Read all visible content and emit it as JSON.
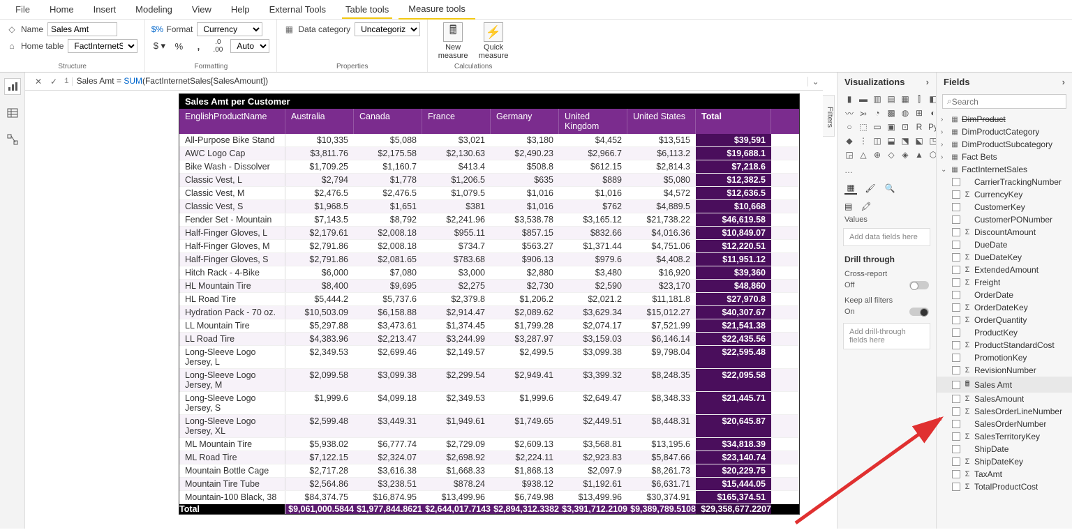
{
  "ribbon": {
    "tabs": [
      "File",
      "Home",
      "Insert",
      "Modeling",
      "View",
      "Help",
      "External Tools",
      "Table tools",
      "Measure tools"
    ],
    "active_tab": "Measure tools",
    "highlight_tab": "Table tools",
    "structure": {
      "name_label": "Name",
      "name_value": "Sales Amt",
      "home_table_label": "Home table",
      "home_table_value": "FactInternetSales",
      "group_label": "Structure"
    },
    "formatting": {
      "format_label": "Format",
      "format_value": "Currency",
      "decimals_value": "Auto",
      "group_label": "Formatting"
    },
    "properties": {
      "data_category_label": "Data category",
      "data_category_value": "Uncategorized",
      "group_label": "Properties"
    },
    "calculations": {
      "new_measure": "New measure",
      "quick_measure": "Quick measure",
      "group_label": "Calculations"
    }
  },
  "formula_bar": {
    "line": "1",
    "prefix": "Sales Amt = ",
    "func": "SUM",
    "args": "(FactInternetSales[SalesAmount])"
  },
  "filters_label": "Filters",
  "matrix": {
    "title": "Sales Amt per Customer",
    "row_header": "EnglishProductName",
    "col_headers": [
      "Australia",
      "Canada",
      "France",
      "Germany",
      "United Kingdom",
      "United States",
      "Total"
    ],
    "rows": [
      {
        "name": "All-Purpose Bike Stand",
        "v": [
          "$10,335",
          "$5,088",
          "$3,021",
          "$3,180",
          "$4,452",
          "$13,515",
          "$39,591"
        ]
      },
      {
        "name": "AWC Logo Cap",
        "v": [
          "$3,811.76",
          "$2,175.58",
          "$2,130.63",
          "$2,490.23",
          "$2,966.7",
          "$6,113.2",
          "$19,688.1"
        ]
      },
      {
        "name": "Bike Wash - Dissolver",
        "v": [
          "$1,709.25",
          "$1,160.7",
          "$413.4",
          "$508.8",
          "$612.15",
          "$2,814.3",
          "$7,218.6"
        ]
      },
      {
        "name": "Classic Vest, L",
        "v": [
          "$2,794",
          "$1,778",
          "$1,206.5",
          "$635",
          "$889",
          "$5,080",
          "$12,382.5"
        ]
      },
      {
        "name": "Classic Vest, M",
        "v": [
          "$2,476.5",
          "$2,476.5",
          "$1,079.5",
          "$1,016",
          "$1,016",
          "$4,572",
          "$12,636.5"
        ]
      },
      {
        "name": "Classic Vest, S",
        "v": [
          "$1,968.5",
          "$1,651",
          "$381",
          "$1,016",
          "$762",
          "$4,889.5",
          "$10,668"
        ]
      },
      {
        "name": "Fender Set - Mountain",
        "v": [
          "$7,143.5",
          "$8,792",
          "$2,241.96",
          "$3,538.78",
          "$3,165.12",
          "$21,738.22",
          "$46,619.58"
        ]
      },
      {
        "name": "Half-Finger Gloves, L",
        "v": [
          "$2,179.61",
          "$2,008.18",
          "$955.11",
          "$857.15",
          "$832.66",
          "$4,016.36",
          "$10,849.07"
        ]
      },
      {
        "name": "Half-Finger Gloves, M",
        "v": [
          "$2,791.86",
          "$2,008.18",
          "$734.7",
          "$563.27",
          "$1,371.44",
          "$4,751.06",
          "$12,220.51"
        ]
      },
      {
        "name": "Half-Finger Gloves, S",
        "v": [
          "$2,791.86",
          "$2,081.65",
          "$783.68",
          "$906.13",
          "$979.6",
          "$4,408.2",
          "$11,951.12"
        ]
      },
      {
        "name": "Hitch Rack - 4-Bike",
        "v": [
          "$6,000",
          "$7,080",
          "$3,000",
          "$2,880",
          "$3,480",
          "$16,920",
          "$39,360"
        ]
      },
      {
        "name": "HL Mountain Tire",
        "v": [
          "$8,400",
          "$9,695",
          "$2,275",
          "$2,730",
          "$2,590",
          "$23,170",
          "$48,860"
        ]
      },
      {
        "name": "HL Road Tire",
        "v": [
          "$5,444.2",
          "$5,737.6",
          "$2,379.8",
          "$1,206.2",
          "$2,021.2",
          "$11,181.8",
          "$27,970.8"
        ]
      },
      {
        "name": "Hydration Pack - 70 oz.",
        "v": [
          "$10,503.09",
          "$6,158.88",
          "$2,914.47",
          "$2,089.62",
          "$3,629.34",
          "$15,012.27",
          "$40,307.67"
        ]
      },
      {
        "name": "LL Mountain Tire",
        "v": [
          "$5,297.88",
          "$3,473.61",
          "$1,374.45",
          "$1,799.28",
          "$2,074.17",
          "$7,521.99",
          "$21,541.38"
        ]
      },
      {
        "name": "LL Road Tire",
        "v": [
          "$4,383.96",
          "$2,213.47",
          "$3,244.99",
          "$3,287.97",
          "$3,159.03",
          "$6,146.14",
          "$22,435.56"
        ]
      },
      {
        "name": "Long-Sleeve Logo Jersey, L",
        "v": [
          "$2,349.53",
          "$2,699.46",
          "$2,149.57",
          "$2,499.5",
          "$3,099.38",
          "$9,798.04",
          "$22,595.48"
        ]
      },
      {
        "name": "Long-Sleeve Logo Jersey, M",
        "v": [
          "$2,099.58",
          "$3,099.38",
          "$2,299.54",
          "$2,949.41",
          "$3,399.32",
          "$8,248.35",
          "$22,095.58"
        ]
      },
      {
        "name": "Long-Sleeve Logo Jersey, S",
        "v": [
          "$1,999.6",
          "$4,099.18",
          "$2,349.53",
          "$1,999.6",
          "$2,649.47",
          "$8,348.33",
          "$21,445.71"
        ]
      },
      {
        "name": "Long-Sleeve Logo Jersey, XL",
        "v": [
          "$2,599.48",
          "$3,449.31",
          "$1,949.61",
          "$1,749.65",
          "$2,449.51",
          "$8,448.31",
          "$20,645.87"
        ]
      },
      {
        "name": "ML Mountain Tire",
        "v": [
          "$5,938.02",
          "$6,777.74",
          "$2,729.09",
          "$2,609.13",
          "$3,568.81",
          "$13,195.6",
          "$34,818.39"
        ]
      },
      {
        "name": "ML Road Tire",
        "v": [
          "$7,122.15",
          "$2,324.07",
          "$2,698.92",
          "$2,224.11",
          "$2,923.83",
          "$5,847.66",
          "$23,140.74"
        ]
      },
      {
        "name": "Mountain Bottle Cage",
        "v": [
          "$2,717.28",
          "$3,616.38",
          "$1,668.33",
          "$1,868.13",
          "$2,097.9",
          "$8,261.73",
          "$20,229.75"
        ]
      },
      {
        "name": "Mountain Tire Tube",
        "v": [
          "$2,564.86",
          "$3,238.51",
          "$878.24",
          "$938.12",
          "$1,192.61",
          "$6,631.71",
          "$15,444.05"
        ]
      },
      {
        "name": "Mountain-100 Black, 38",
        "v": [
          "$84,374.75",
          "$16,874.95",
          "$13,499.96",
          "$6,749.98",
          "$13,499.96",
          "$30,374.91",
          "$165,374.51"
        ]
      }
    ],
    "total_row": {
      "name": "Total",
      "v": [
        "$9,061,000.5844",
        "$1,977,844.8621",
        "$2,644,017.7143",
        "$2,894,312.3382",
        "$3,391,712.2109",
        "$9,389,789.5108",
        "$29,358,677.2207"
      ]
    }
  },
  "viz_pane": {
    "title": "Visualizations",
    "values_label": "Values",
    "values_placeholder": "Add data fields here",
    "drill_title": "Drill through",
    "cross_report": "Cross-report",
    "off": "Off",
    "keep_filters": "Keep all filters",
    "on": "On",
    "drill_placeholder": "Add drill-through fields here"
  },
  "fields_pane": {
    "title": "Fields",
    "search_placeholder": "Search",
    "tables": [
      {
        "name": "DimProduct",
        "expanded": false,
        "dim": true
      },
      {
        "name": "DimProductCategory",
        "expanded": false
      },
      {
        "name": "DimProductSubcategory",
        "expanded": false
      },
      {
        "name": "Fact Bets",
        "expanded": false
      },
      {
        "name": "FactInternetSales",
        "expanded": true
      }
    ],
    "fields": [
      {
        "name": "CarrierTrackingNumber",
        "sigma": false
      },
      {
        "name": "CurrencyKey",
        "sigma": true
      },
      {
        "name": "CustomerKey",
        "sigma": false
      },
      {
        "name": "CustomerPONumber",
        "sigma": false
      },
      {
        "name": "DiscountAmount",
        "sigma": true
      },
      {
        "name": "DueDate",
        "sigma": false
      },
      {
        "name": "DueDateKey",
        "sigma": true
      },
      {
        "name": "ExtendedAmount",
        "sigma": true
      },
      {
        "name": "Freight",
        "sigma": true
      },
      {
        "name": "OrderDate",
        "sigma": false
      },
      {
        "name": "OrderDateKey",
        "sigma": true
      },
      {
        "name": "OrderQuantity",
        "sigma": true
      },
      {
        "name": "ProductKey",
        "sigma": false
      },
      {
        "name": "ProductStandardCost",
        "sigma": true
      },
      {
        "name": "PromotionKey",
        "sigma": false
      },
      {
        "name": "RevisionNumber",
        "sigma": true
      },
      {
        "name": "Sales Amt",
        "measure": true,
        "selected": true
      },
      {
        "name": "SalesAmount",
        "sigma": true
      },
      {
        "name": "SalesOrderLineNumber",
        "sigma": true
      },
      {
        "name": "SalesOrderNumber",
        "sigma": false
      },
      {
        "name": "SalesTerritoryKey",
        "sigma": true
      },
      {
        "name": "ShipDate",
        "sigma": false
      },
      {
        "name": "ShipDateKey",
        "sigma": true
      },
      {
        "name": "TaxAmt",
        "sigma": true
      },
      {
        "name": "TotalProductCost",
        "sigma": true
      }
    ]
  }
}
